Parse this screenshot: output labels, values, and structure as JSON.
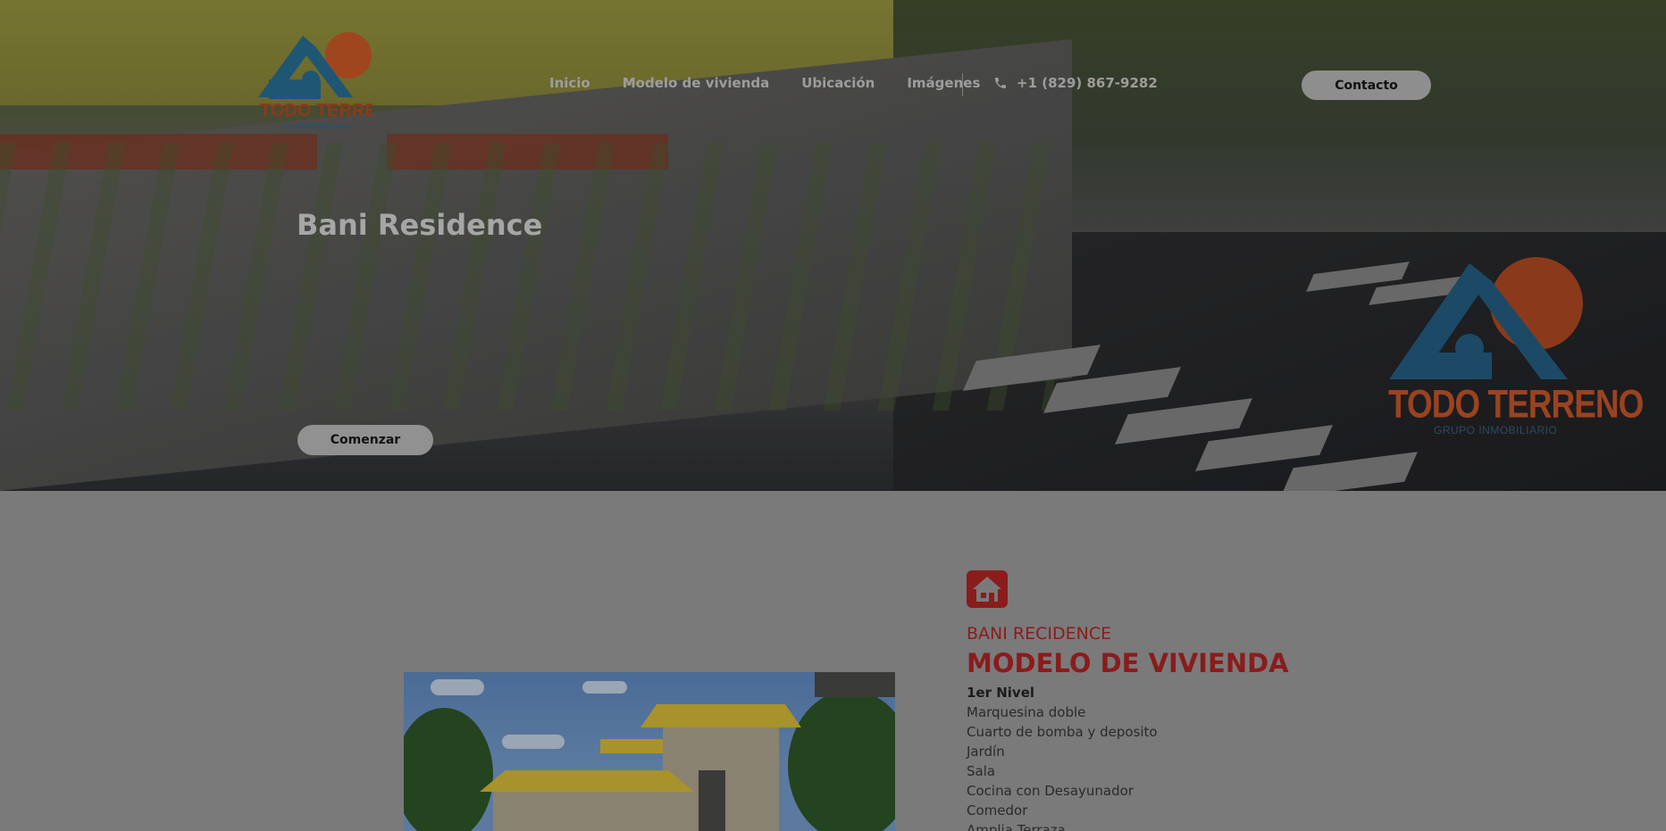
{
  "header": {
    "logo_alt": "Todo Terreno Grupo Inmobiliario",
    "nav": [
      "Inicio",
      "Modelo de vivienda",
      "Ubicación",
      "Imágenes"
    ],
    "phone": "+1 (829) 867-9282",
    "contact_label": "Contacto"
  },
  "hero": {
    "title": "Bani Residence",
    "cta_label": "Comenzar",
    "brand_name": "TODO TERRENO",
    "brand_sub": "GRUPO INMOBILIARIO"
  },
  "section": {
    "eyebrow": "BANI RECIDENCE",
    "title": "MODELO DE VIVIENDA",
    "features_heading": "1er Nivel",
    "features": [
      "Marquesina doble",
      "Cuarto de bomba y deposito",
      "Jardín",
      "Sala",
      "Cocina con Desayunador",
      "Comedor",
      "Amplia Terraza"
    ]
  },
  "colors": {
    "accent": "#8a1c1c",
    "brand_orange": "#9a4320",
    "brand_blue": "#1f4f6b"
  },
  "icons": [
    "phone-icon",
    "house-icon"
  ]
}
